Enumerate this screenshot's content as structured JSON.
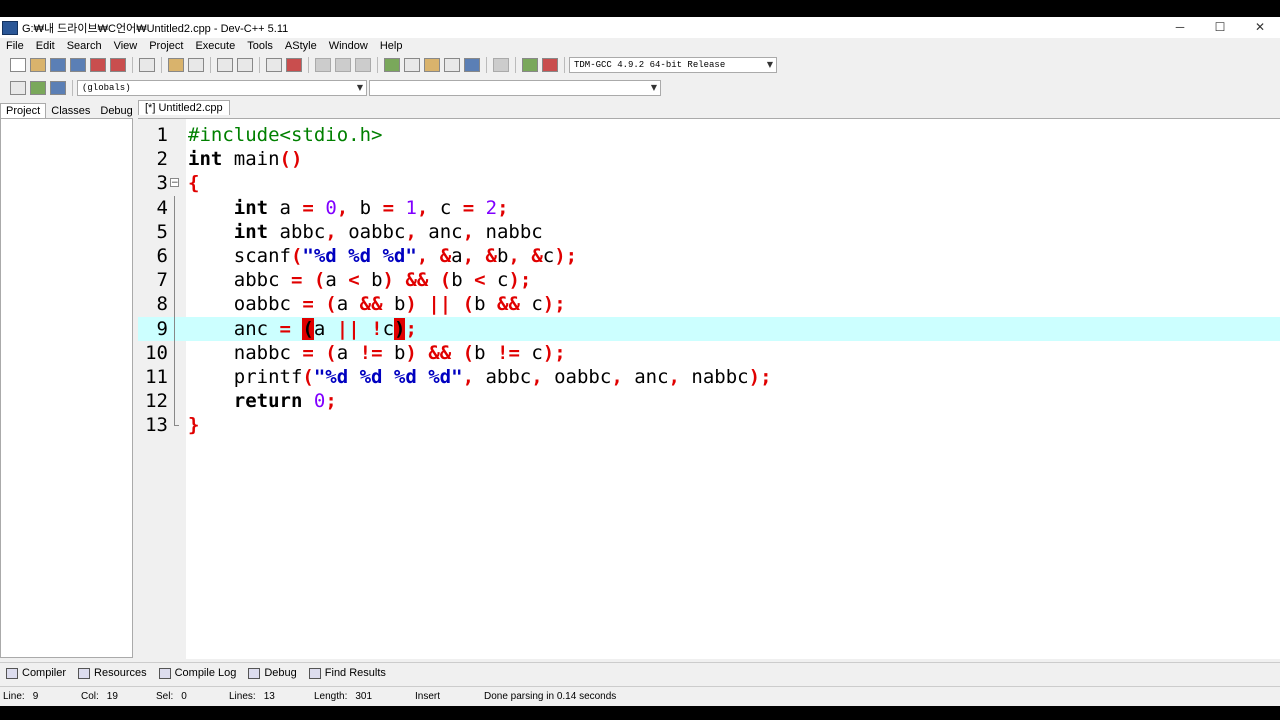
{
  "window": {
    "title": "G:₩내 드라이브₩C언어₩Untitled2.cpp - Dev-C++ 5.11",
    "minimize": "─",
    "maximize": "☐",
    "close": "✕"
  },
  "menu": [
    "File",
    "Edit",
    "Search",
    "View",
    "Project",
    "Execute",
    "Tools",
    "AStyle",
    "Window",
    "Help"
  ],
  "toolbar": {
    "compiler_select": "TDM-GCC 4.9.2 64-bit Release",
    "scope_select": "(globals)",
    "member_select": ""
  },
  "left_tabs": [
    "Project",
    "Classes",
    "Debug"
  ],
  "editor": {
    "tab_label": "[*] Untitled2.cpp",
    "active_line": 9,
    "lines": [
      {
        "n": "1",
        "tokens": [
          {
            "t": "#include<stdio.h>",
            "c": "pp"
          }
        ]
      },
      {
        "n": "2",
        "tokens": [
          {
            "t": "int",
            "c": "kw"
          },
          {
            "t": " main",
            "c": "id"
          },
          {
            "t": "()",
            "c": "sym"
          }
        ]
      },
      {
        "n": "3",
        "tokens": [
          {
            "t": "{",
            "c": "sym"
          }
        ]
      },
      {
        "n": "4",
        "tokens": [
          {
            "t": "    ",
            "c": "id"
          },
          {
            "t": "int",
            "c": "kw"
          },
          {
            "t": " a ",
            "c": "id"
          },
          {
            "t": "=",
            "c": "sym"
          },
          {
            "t": " ",
            "c": "id"
          },
          {
            "t": "0",
            "c": "num"
          },
          {
            "t": ",",
            "c": "sym"
          },
          {
            "t": " b ",
            "c": "id"
          },
          {
            "t": "=",
            "c": "sym"
          },
          {
            "t": " ",
            "c": "id"
          },
          {
            "t": "1",
            "c": "num"
          },
          {
            "t": ",",
            "c": "sym"
          },
          {
            "t": " c ",
            "c": "id"
          },
          {
            "t": "=",
            "c": "sym"
          },
          {
            "t": " ",
            "c": "id"
          },
          {
            "t": "2",
            "c": "num"
          },
          {
            "t": ";",
            "c": "sym"
          }
        ]
      },
      {
        "n": "5",
        "tokens": [
          {
            "t": "    ",
            "c": "id"
          },
          {
            "t": "int",
            "c": "kw"
          },
          {
            "t": " abbc",
            "c": "id"
          },
          {
            "t": ",",
            "c": "sym"
          },
          {
            "t": " oabbc",
            "c": "id"
          },
          {
            "t": ",",
            "c": "sym"
          },
          {
            "t": " anc",
            "c": "id"
          },
          {
            "t": ",",
            "c": "sym"
          },
          {
            "t": " nabbc",
            "c": "id"
          }
        ]
      },
      {
        "n": "6",
        "tokens": [
          {
            "t": "    scanf",
            "c": "id"
          },
          {
            "t": "(",
            "c": "sym"
          },
          {
            "t": "\"%d %d %d\"",
            "c": "str"
          },
          {
            "t": ",",
            "c": "sym"
          },
          {
            "t": " ",
            "c": "id"
          },
          {
            "t": "&",
            "c": "sym"
          },
          {
            "t": "a",
            "c": "id"
          },
          {
            "t": ",",
            "c": "sym"
          },
          {
            "t": " ",
            "c": "id"
          },
          {
            "t": "&",
            "c": "sym"
          },
          {
            "t": "b",
            "c": "id"
          },
          {
            "t": ",",
            "c": "sym"
          },
          {
            "t": " ",
            "c": "id"
          },
          {
            "t": "&",
            "c": "sym"
          },
          {
            "t": "c",
            "c": "id"
          },
          {
            "t": ");",
            "c": "sym"
          }
        ]
      },
      {
        "n": "7",
        "tokens": [
          {
            "t": "    abbc ",
            "c": "id"
          },
          {
            "t": "=",
            "c": "sym"
          },
          {
            "t": " ",
            "c": "id"
          },
          {
            "t": "(",
            "c": "sym"
          },
          {
            "t": "a ",
            "c": "id"
          },
          {
            "t": "<",
            "c": "sym"
          },
          {
            "t": " b",
            "c": "id"
          },
          {
            "t": ")",
            "c": "sym"
          },
          {
            "t": " ",
            "c": "id"
          },
          {
            "t": "&&",
            "c": "sym"
          },
          {
            "t": " ",
            "c": "id"
          },
          {
            "t": "(",
            "c": "sym"
          },
          {
            "t": "b ",
            "c": "id"
          },
          {
            "t": "<",
            "c": "sym"
          },
          {
            "t": " c",
            "c": "id"
          },
          {
            "t": ");",
            "c": "sym"
          }
        ]
      },
      {
        "n": "8",
        "tokens": [
          {
            "t": "    oabbc ",
            "c": "id"
          },
          {
            "t": "=",
            "c": "sym"
          },
          {
            "t": " ",
            "c": "id"
          },
          {
            "t": "(",
            "c": "sym"
          },
          {
            "t": "a ",
            "c": "id"
          },
          {
            "t": "&&",
            "c": "sym"
          },
          {
            "t": " b",
            "c": "id"
          },
          {
            "t": ")",
            "c": "sym"
          },
          {
            "t": " ",
            "c": "id"
          },
          {
            "t": "||",
            "c": "sym"
          },
          {
            "t": " ",
            "c": "id"
          },
          {
            "t": "(",
            "c": "sym"
          },
          {
            "t": "b ",
            "c": "id"
          },
          {
            "t": "&&",
            "c": "sym"
          },
          {
            "t": " c",
            "c": "id"
          },
          {
            "t": ");",
            "c": "sym"
          }
        ]
      },
      {
        "n": "9",
        "tokens": [
          {
            "t": "    anc ",
            "c": "id"
          },
          {
            "t": "=",
            "c": "sym"
          },
          {
            "t": " ",
            "c": "id"
          },
          {
            "t": "(",
            "c": "hl"
          },
          {
            "t": "a ",
            "c": "id"
          },
          {
            "t": "||",
            "c": "sym"
          },
          {
            "t": " ",
            "c": "id"
          },
          {
            "t": "!",
            "c": "sym"
          },
          {
            "t": "c",
            "c": "id"
          },
          {
            "t": ")",
            "c": "hl"
          },
          {
            "t": ";",
            "c": "sym"
          }
        ]
      },
      {
        "n": "10",
        "tokens": [
          {
            "t": "    nabbc ",
            "c": "id"
          },
          {
            "t": "=",
            "c": "sym"
          },
          {
            "t": " ",
            "c": "id"
          },
          {
            "t": "(",
            "c": "sym"
          },
          {
            "t": "a ",
            "c": "id"
          },
          {
            "t": "!=",
            "c": "sym"
          },
          {
            "t": " b",
            "c": "id"
          },
          {
            "t": ")",
            "c": "sym"
          },
          {
            "t": " ",
            "c": "id"
          },
          {
            "t": "&&",
            "c": "sym"
          },
          {
            "t": " ",
            "c": "id"
          },
          {
            "t": "(",
            "c": "sym"
          },
          {
            "t": "b ",
            "c": "id"
          },
          {
            "t": "!=",
            "c": "sym"
          },
          {
            "t": " c",
            "c": "id"
          },
          {
            "t": ");",
            "c": "sym"
          }
        ]
      },
      {
        "n": "11",
        "tokens": [
          {
            "t": "    printf",
            "c": "id"
          },
          {
            "t": "(",
            "c": "sym"
          },
          {
            "t": "\"%d %d %d %d\"",
            "c": "str"
          },
          {
            "t": ",",
            "c": "sym"
          },
          {
            "t": " abbc",
            "c": "id"
          },
          {
            "t": ",",
            "c": "sym"
          },
          {
            "t": " oabbc",
            "c": "id"
          },
          {
            "t": ",",
            "c": "sym"
          },
          {
            "t": " anc",
            "c": "id"
          },
          {
            "t": ",",
            "c": "sym"
          },
          {
            "t": " nabbc",
            "c": "id"
          },
          {
            "t": ");",
            "c": "sym"
          }
        ]
      },
      {
        "n": "12",
        "tokens": [
          {
            "t": "    ",
            "c": "id"
          },
          {
            "t": "return",
            "c": "kw"
          },
          {
            "t": " ",
            "c": "id"
          },
          {
            "t": "0",
            "c": "num"
          },
          {
            "t": ";",
            "c": "sym"
          }
        ]
      },
      {
        "n": "13",
        "tokens": [
          {
            "t": "}",
            "c": "sym"
          }
        ]
      }
    ]
  },
  "bottom_tabs": [
    "Compiler",
    "Resources",
    "Compile Log",
    "Debug",
    "Find Results"
  ],
  "status": {
    "line_label": "Line:",
    "line_value": "9",
    "col_label": "Col:",
    "col_value": "19",
    "sel_label": "Sel:",
    "sel_value": "0",
    "lines_label": "Lines:",
    "lines_value": "13",
    "length_label": "Length:",
    "length_value": "301",
    "mode": "Insert",
    "message": "Done parsing in 0.14 seconds"
  }
}
